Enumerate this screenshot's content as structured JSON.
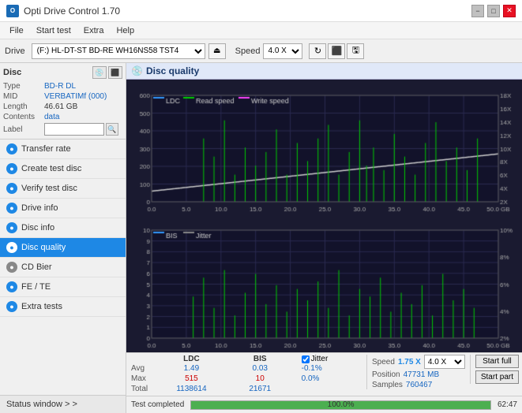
{
  "app": {
    "title": "Opti Drive Control 1.70",
    "logo_text": "O"
  },
  "title_bar": {
    "title": "Opti Drive Control 1.70",
    "minimize_label": "−",
    "maximize_label": "□",
    "close_label": "✕"
  },
  "menu": {
    "items": [
      "File",
      "Start test",
      "Extra",
      "Help"
    ]
  },
  "drive_toolbar": {
    "drive_label": "Drive",
    "drive_value": "(F:)  HL-DT-ST BD-RE  WH16NS58 TST4",
    "speed_label": "Speed",
    "speed_value": "4.0 X",
    "eject_icon": "⏏"
  },
  "sidebar": {
    "disc_title": "Disc",
    "disc_type_label": "Type",
    "disc_type_value": "BD-R DL",
    "disc_mid_label": "MID",
    "disc_mid_value": "VERBATIMf (000)",
    "disc_length_label": "Length",
    "disc_length_value": "46.61 GB",
    "disc_contents_label": "Contents",
    "disc_contents_value": "data",
    "disc_label_label": "Label",
    "disc_label_value": "",
    "menu_items": [
      {
        "id": "transfer-rate",
        "label": "Transfer rate",
        "active": false
      },
      {
        "id": "create-test-disc",
        "label": "Create test disc",
        "active": false
      },
      {
        "id": "verify-test-disc",
        "label": "Verify test disc",
        "active": false
      },
      {
        "id": "drive-info",
        "label": "Drive info",
        "active": false
      },
      {
        "id": "disc-info",
        "label": "Disc info",
        "active": false
      },
      {
        "id": "disc-quality",
        "label": "Disc quality",
        "active": true
      },
      {
        "id": "cd-bier",
        "label": "CD Bier",
        "active": false
      },
      {
        "id": "fe-te",
        "label": "FE / TE",
        "active": false
      },
      {
        "id": "extra-tests",
        "label": "Extra tests",
        "active": false
      }
    ],
    "status_window_label": "Status window > >"
  },
  "content": {
    "title": "Disc quality",
    "upper_chart": {
      "legend": [
        {
          "id": "ldc",
          "label": "LDC",
          "color": "#3399ff"
        },
        {
          "id": "read-speed",
          "label": "Read speed",
          "color": "#00cc00"
        },
        {
          "id": "write-speed",
          "label": "Write speed",
          "color": "#ff00ff"
        }
      ],
      "y_labels_left": [
        "600",
        "500",
        "400",
        "300",
        "200",
        "100",
        "0.0"
      ],
      "y_labels_right": [
        "18X",
        "16X",
        "14X",
        "12X",
        "10X",
        "8X",
        "6X",
        "4X",
        "2X"
      ],
      "x_labels": [
        "0.0",
        "5.0",
        "10.0",
        "15.0",
        "20.0",
        "25.0",
        "30.0",
        "35.0",
        "40.0",
        "45.0",
        "50.0 GB"
      ]
    },
    "lower_chart": {
      "legend": [
        {
          "id": "bis",
          "label": "BIS",
          "color": "#3399ff"
        },
        {
          "id": "jitter",
          "label": "Jitter",
          "color": "#888"
        }
      ],
      "y_labels_left": [
        "10",
        "9",
        "8",
        "7",
        "6",
        "5",
        "4",
        "3",
        "2",
        "1"
      ],
      "y_labels_right": [
        "10%",
        "8%",
        "6%",
        "4%",
        "2%"
      ],
      "x_labels": [
        "0.0",
        "5.0",
        "10.0",
        "15.0",
        "20.0",
        "25.0",
        "30.0",
        "35.0",
        "40.0",
        "45.0",
        "50.0 GB"
      ]
    },
    "stats": {
      "columns": [
        "",
        "LDC",
        "BIS",
        "",
        "Jitter",
        "Speed",
        "",
        ""
      ],
      "avg_label": "Avg",
      "max_label": "Max",
      "total_label": "Total",
      "ldc_avg": "1.49",
      "ldc_max": "515",
      "ldc_total": "1138614",
      "bis_avg": "0.03",
      "bis_max": "10",
      "bis_total": "21671",
      "jitter_avg": "-0.1%",
      "jitter_max": "0.0%",
      "jitter_total": "",
      "jitter_checked": true,
      "jitter_label": "Jitter",
      "speed_label": "Speed",
      "speed_value": "1.75 X",
      "speed_select": "4.0 X",
      "position_label": "Position",
      "position_value": "47731 MB",
      "samples_label": "Samples",
      "samples_value": "760467",
      "start_full_label": "Start full",
      "start_part_label": "Start part"
    },
    "progress": {
      "status_text": "Test completed",
      "percent": 100,
      "percent_text": "100.0%",
      "time_text": "62:47"
    }
  }
}
